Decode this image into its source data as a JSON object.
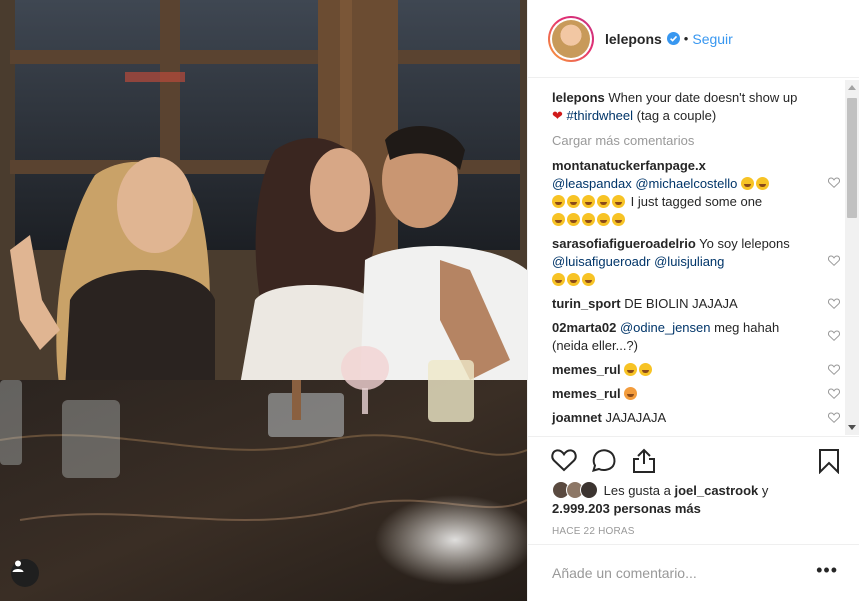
{
  "header": {
    "username": "lelepons",
    "separator": "•",
    "follow_label": "Seguir"
  },
  "caption": {
    "username": "lelepons",
    "text": "When your date doesn't show up",
    "hashtag": "#thirdwheel",
    "text_after": "(tag a couple)"
  },
  "load_more_label": "Cargar más comentarios",
  "comments": [
    {
      "username": "montanatuckerfanpage.x",
      "mention1": "@leaspandax",
      "mention2": "@michaelcostello",
      "text": "I just tagged some one"
    },
    {
      "username": "sarasofiafigueroadelrio",
      "text": "Yo soy lelepons",
      "mention1": "@luisafigueroadr",
      "mention2": "@luisjuliang"
    },
    {
      "username": "turin_sport",
      "text": "DE BIOLIN JAJAJA"
    },
    {
      "username": "02marta02",
      "mention1": "@odine_jensen",
      "text": "meg hahah (neida eller...?)"
    },
    {
      "username": "memes_rul",
      "text": ""
    },
    {
      "username": "memes_rul",
      "text": ""
    },
    {
      "username": "joamnet",
      "text": "JAJAJAJA"
    }
  ],
  "likes": {
    "prefix": "Les gusta a",
    "user": "joel_castrook",
    "conj": "y",
    "count": "2.999.203 personas más"
  },
  "timestamp": "HACE 22 HORAS",
  "add_comment_placeholder": "Añade un comentario...",
  "more_label": "•••",
  "colors": {
    "link": "#3897f0",
    "verified": "#3897f0",
    "muted": "#999999"
  },
  "icons": [
    "heart-icon",
    "comment-icon",
    "share-icon",
    "bookmark-icon",
    "verified-icon",
    "user-tag-icon",
    "more-options-icon"
  ]
}
